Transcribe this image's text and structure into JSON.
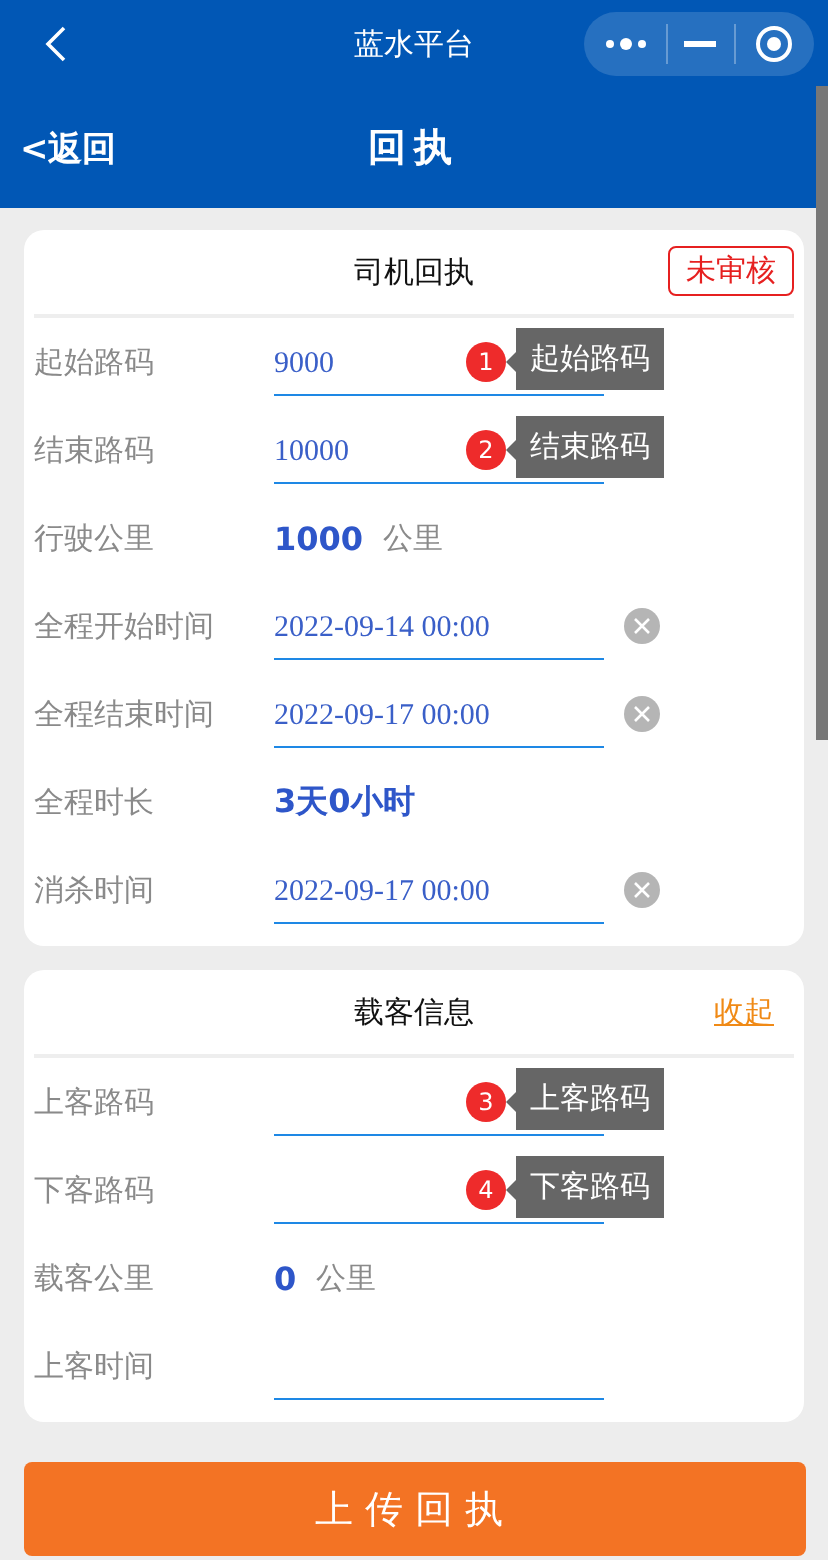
{
  "mini_bar": {
    "title": "蓝水平台"
  },
  "nav": {
    "back": "<返回",
    "title": "回执"
  },
  "sections": [
    {
      "title": "司机回执",
      "badge": "未审核",
      "fields": [
        {
          "kind": "input",
          "label": "起始路码",
          "value": "9000",
          "hint": {
            "number": "1",
            "text": "起始路码"
          }
        },
        {
          "kind": "input",
          "label": "结束路码",
          "value": "10000",
          "hint": {
            "number": "2",
            "text": "结束路码"
          }
        },
        {
          "kind": "reading",
          "label": "行驶公里",
          "value": "1000",
          "unit": "公里"
        },
        {
          "kind": "datetime",
          "label": "全程开始时间",
          "value": "2022-09-14 00:00"
        },
        {
          "kind": "datetime",
          "label": "全程结束时间",
          "value": "2022-09-17 00:00"
        },
        {
          "kind": "reading",
          "label": "全程时长",
          "value": "3天0小时"
        },
        {
          "kind": "datetime",
          "label": "消杀时间",
          "value": "2022-09-17 00:00"
        }
      ]
    },
    {
      "title": "载客信息",
      "action": "收起",
      "fields": [
        {
          "kind": "input",
          "label": "上客路码",
          "hint": {
            "number": "3",
            "text": "上客路码"
          }
        },
        {
          "kind": "input",
          "label": "下客路码",
          "hint": {
            "number": "4",
            "text": "下客路码"
          }
        },
        {
          "kind": "reading",
          "label": "载客公里",
          "value": "0",
          "unit": "公里"
        },
        {
          "kind": "input",
          "label": "上客时间"
        }
      ]
    }
  ],
  "submit": "上传回执"
}
